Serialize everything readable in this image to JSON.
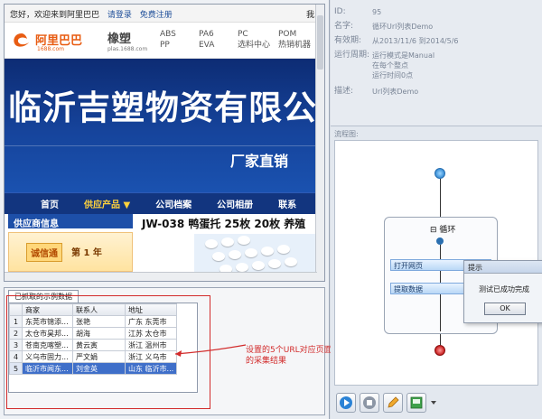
{
  "browser": {
    "topbar": {
      "greeting": "您好，欢迎来到阿里巴巴",
      "login": "请登录",
      "register": "免费注册",
      "right_text": "我"
    },
    "logo": {
      "name": "阿里巴巴",
      "sub": "1688.com"
    },
    "category": {
      "title": "橡塑",
      "sub": "plas.1688.com"
    },
    "category_links": [
      [
        "ABS",
        "PP"
      ],
      [
        "PA6",
        "EVA"
      ],
      [
        "PC",
        "选料中心"
      ],
      [
        "POM",
        "热销机器"
      ]
    ],
    "banner": {
      "title": "临沂吉塑物资有限公",
      "slogan": "厂家直销"
    },
    "nav": [
      "首页",
      "供应产品 ▼",
      "公司档案",
      "公司相册",
      "联系"
    ],
    "supplier": {
      "header": "供应商信息",
      "badge": "诚信通",
      "year": "第 1 年"
    },
    "product": {
      "title": "JW-038 鸭蛋托 25枚 20枚 养殖"
    }
  },
  "table_panel": {
    "tab": "已抓取的示例数据",
    "columns": [
      "商家",
      "联系人",
      "地址"
    ],
    "rows": [
      {
        "n": "1",
        "merchant": "东莞市锦添...",
        "contact": "张艳",
        "address": "广东 东莞市"
      },
      {
        "n": "2",
        "merchant": "太仓市昊邦...",
        "contact": "胡海",
        "address": "江苏 太仓市"
      },
      {
        "n": "3",
        "merchant": "苍南克喀塑...",
        "contact": "黄云寅",
        "address": "浙江 温州市"
      },
      {
        "n": "4",
        "merchant": "义乌市固力...",
        "contact": "严文娟",
        "address": "浙江 义乌市"
      },
      {
        "n": "5",
        "merchant": "临沂市闻东...",
        "contact": "刘金英",
        "address": "山东 临沂市..."
      }
    ],
    "annotation": "设置的5个URL对应页面的采集结果"
  },
  "properties": {
    "rows": [
      {
        "label": "ID:",
        "value": "95"
      },
      {
        "label": "名字:",
        "value": "循环Url列表Demo"
      },
      {
        "label": "有效期:",
        "value": "从2013/11/6 到2014/5/6"
      },
      {
        "label": "运行周期:",
        "value": "运行模式是Manual"
      },
      {
        "label": "",
        "value": "在每个整点"
      },
      {
        "label": "",
        "value": "运行时间0点"
      },
      {
        "label": "描述:",
        "value": "Url列表Demo"
      }
    ],
    "flow_label": "流程图:"
  },
  "flow": {
    "loop_title": "⊟ 循环",
    "steps": [
      "打开网页",
      "提取数据"
    ]
  },
  "dialog": {
    "title": "提示",
    "message": "测试已成功完成",
    "ok": "OK"
  }
}
